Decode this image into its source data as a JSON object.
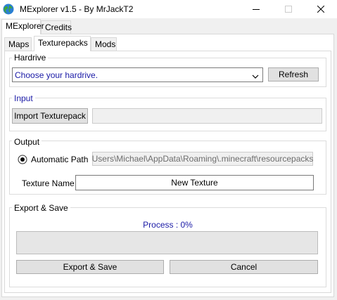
{
  "window": {
    "title": "MExplorer v1.5 - By MrJackT2",
    "icons": {
      "app": "globe-icon",
      "minimize": "minimize-icon",
      "maximize": "maximize-icon",
      "close": "close-icon"
    }
  },
  "main_tabs": [
    {
      "label": "MExplorer",
      "active": true
    },
    {
      "label": "Credits",
      "active": false
    }
  ],
  "sub_tabs": [
    {
      "label": "Maps",
      "active": false
    },
    {
      "label": "Texturepacks",
      "active": true
    },
    {
      "label": "Mods",
      "active": false
    }
  ],
  "hardrive": {
    "group_label": "Hardrive",
    "select_value": "Choose your hardrive.",
    "refresh_label": "Refresh"
  },
  "input": {
    "group_label": "Input",
    "import_label": "Import Texturepack",
    "path_value": ""
  },
  "output": {
    "group_label": "Output",
    "automatic_path_label": "Automatic Path",
    "automatic_path_checked": true,
    "automatic_path_value": "Users\\Michael\\AppData\\Roaming\\.minecraft\\resourcepacks",
    "texture_name_label": "Texture Name :",
    "texture_name_value": "New Texture"
  },
  "export": {
    "group_label": "Export & Save",
    "process_text": "Process : 0%",
    "progress": 0,
    "export_label": "Export & Save",
    "cancel_label": "Cancel"
  },
  "colors": {
    "accent_blue": "#1a1aa6",
    "group_border": "#dcdcdc",
    "button_bg": "#e1e1e1"
  }
}
